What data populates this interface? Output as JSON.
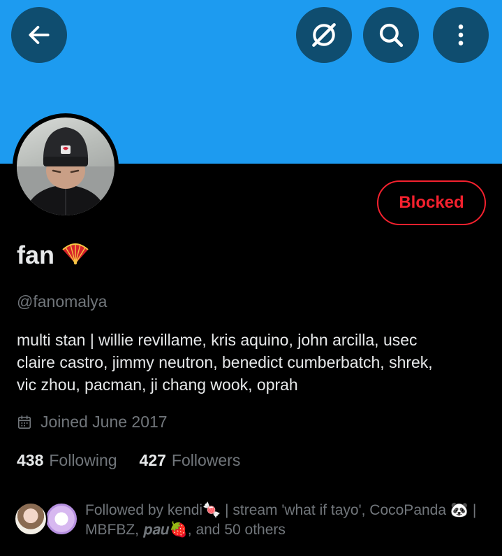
{
  "header": {
    "back_icon": "arrow-left-icon",
    "grok_icon": "grok-slash-icon",
    "search_icon": "search-icon",
    "more_icon": "more-vertical-icon",
    "banner_color": "#1d9bf0"
  },
  "profile": {
    "display_name": "fan",
    "name_emoji": "🪭",
    "handle": "@fanomalya",
    "action_button": "Blocked",
    "action_color": "#f4212e",
    "bio_lines": [
      "multi stan | willie revillame, kris aquino, john arcilla, usec",
      "claire castro, jimmy neutron, benedict cumberbatch, shrek,",
      "vic zhou, pacman, ji chang wook, oprah"
    ],
    "joined": "Joined June 2017",
    "following_count": "438",
    "following_label": "Following",
    "followers_count": "427",
    "followers_label": "Followers"
  },
  "followed_by": {
    "line1": "Followed by kendi🍬 | stream 'what if tayo', CocoPanda 🐼 |",
    "line2": "MBFBZ, 𝒑𝒂𝒖🍓, and 50 others"
  }
}
